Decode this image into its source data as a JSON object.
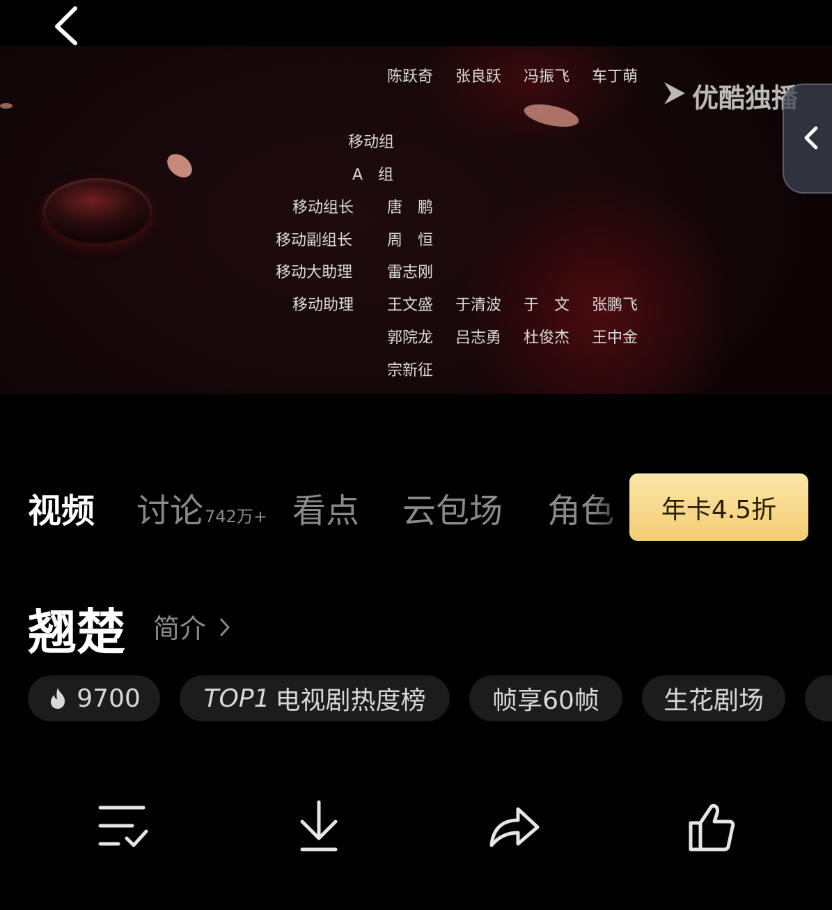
{
  "credits": {
    "row_top": [
      "陈跃奇",
      "张良跃",
      "冯振飞",
      "车丁萌"
    ],
    "group_title": "移动组",
    "sub_group": "A　组",
    "roles": [
      {
        "role": "移动组长",
        "names": [
          "唐　鹏"
        ]
      },
      {
        "role": "移动副组长",
        "names": [
          "周　恒"
        ]
      },
      {
        "role": "移动大助理",
        "names": [
          "雷志刚"
        ]
      },
      {
        "role": "移动助理",
        "names": [
          "王文盛",
          "于清波",
          "于　文",
          "张鹏飞"
        ]
      },
      {
        "role": "",
        "names": [
          "郭院龙",
          "吕志勇",
          "杜俊杰",
          "王中金"
        ]
      },
      {
        "role": "",
        "names": [
          "宗新征"
        ]
      }
    ]
  },
  "watermark": "优酷独播",
  "tabs": [
    {
      "label": "视频",
      "active": true
    },
    {
      "label": "讨论",
      "count": "742万+"
    },
    {
      "label": "看点"
    },
    {
      "label": "云包场"
    },
    {
      "label": "角色"
    }
  ],
  "promo": "年卡4.5折",
  "show": {
    "title": "翘楚",
    "intro_label": "简介"
  },
  "chips": {
    "heat": "9700",
    "rank_prefix": "TOP1",
    "rank_text": "电视剧热度榜",
    "fps": "帧享60帧",
    "theater": "生花剧场"
  },
  "icons": {
    "back": "chevron-left-icon",
    "side": "chevron-left-icon",
    "playlist": "playlist-check-icon",
    "download": "download-icon",
    "share": "share-icon",
    "like": "thumbs-up-icon",
    "heat": "flame-icon"
  },
  "colors": {
    "promo_bg": "#f5d47e",
    "promo_text": "#2a1c05",
    "background": "#000000"
  }
}
